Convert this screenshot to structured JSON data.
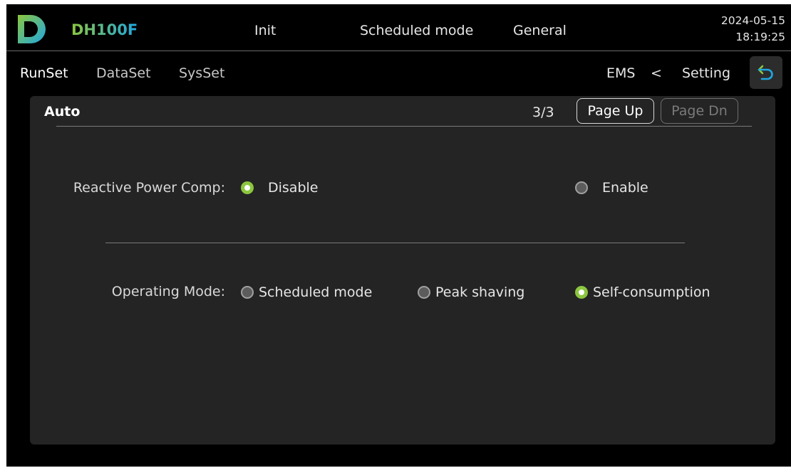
{
  "header": {
    "model": "DH100F",
    "nav": [
      "Init",
      "Scheduled mode",
      "General"
    ],
    "date": "2024-05-15",
    "time": "18:19:25",
    "logo_icon": "dh-logo-icon"
  },
  "subnav": {
    "items": [
      "RunSet",
      "DataSet",
      "SysSet"
    ],
    "active": "RunSet",
    "breadcrumb": {
      "current": "EMS",
      "separator": "<",
      "parent": "Setting"
    },
    "back_icon": "back-arrow-icon"
  },
  "panel": {
    "title": "Auto",
    "page_indicator": "3/3",
    "page_up": "Page Up",
    "page_dn": "Page Dn",
    "reactive": {
      "label": "Reactive Power Comp:",
      "options": [
        "Disable",
        "Enable"
      ],
      "selected": "Disable"
    },
    "operating": {
      "label": "Operating Mode:",
      "options": [
        "Scheduled mode",
        "Peak shaving",
        "Self-consumption"
      ],
      "selected": "Self-consumption"
    }
  },
  "colors": {
    "accent_green": "#8cc63f",
    "logo_gradient": [
      "#8cc63f",
      "#1fa8e0"
    ],
    "background": "#000000",
    "panel": "#242424"
  }
}
